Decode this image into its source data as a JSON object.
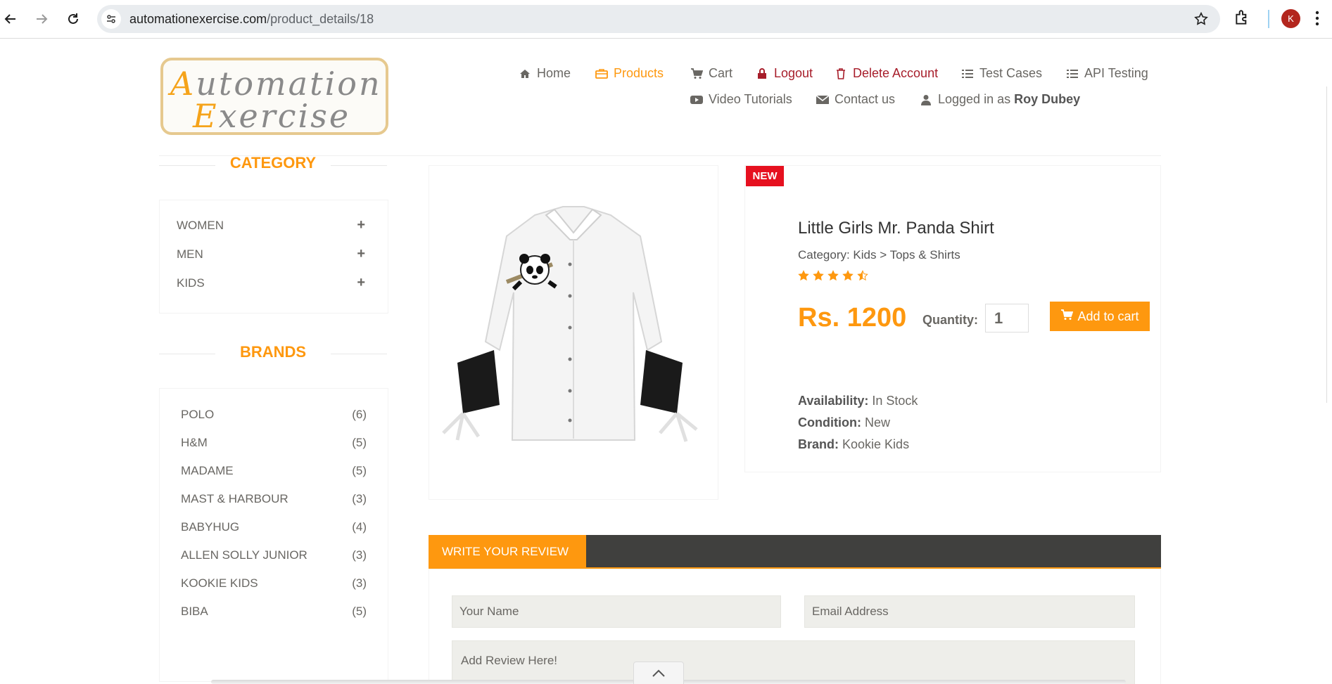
{
  "browser": {
    "url_domain": "automationexercise.com",
    "url_path": "/product_details/18",
    "avatar_letter": "K"
  },
  "logo": {
    "line1": "Automation",
    "line2": "Exercise"
  },
  "nav": {
    "home": "Home",
    "products": "Products",
    "cart": "Cart",
    "logout": "Logout",
    "delete_account": "Delete Account",
    "test_cases": "Test Cases",
    "api_testing": "API Testing",
    "video_tutorials": "Video Tutorials",
    "contact_us": "Contact us",
    "logged_in_prefix": "Logged in as",
    "logged_in_user": "Roy Dubey"
  },
  "sidebar": {
    "category_title": "CATEGORY",
    "categories": [
      "WOMEN",
      "MEN",
      "KIDS"
    ],
    "brands_title": "BRANDS",
    "brands": [
      {
        "name": "POLO",
        "count": "(6)"
      },
      {
        "name": "H&M",
        "count": "(5)"
      },
      {
        "name": "MADAME",
        "count": "(5)"
      },
      {
        "name": "MAST & HARBOUR",
        "count": "(3)"
      },
      {
        "name": "BABYHUG",
        "count": "(4)"
      },
      {
        "name": "ALLEN SOLLY JUNIOR",
        "count": "(3)"
      },
      {
        "name": "KOOKIE KIDS",
        "count": "(3)"
      },
      {
        "name": "BIBA",
        "count": "(5)"
      }
    ]
  },
  "product": {
    "badge": "NEW",
    "name": "Little Girls Mr. Panda Shirt",
    "category": "Category: Kids > Tops & Shirts",
    "rating": 4.5,
    "price": "Rs. 1200",
    "quantity_label": "Quantity:",
    "quantity_value": "1",
    "add_to_cart": "Add to cart",
    "availability_label": "Availability:",
    "availability_value": "In Stock",
    "condition_label": "Condition:",
    "condition_value": "New",
    "brand_label": "Brand:",
    "brand_value": "Kookie Kids"
  },
  "review": {
    "tab": "WRITE YOUR REVIEW",
    "name_placeholder": "Your Name",
    "email_placeholder": "Email Address",
    "review_placeholder": "Add Review Here!"
  },
  "colors": {
    "accent": "#fe980f",
    "danger": "#a71d2a",
    "badge": "#e6101f"
  }
}
